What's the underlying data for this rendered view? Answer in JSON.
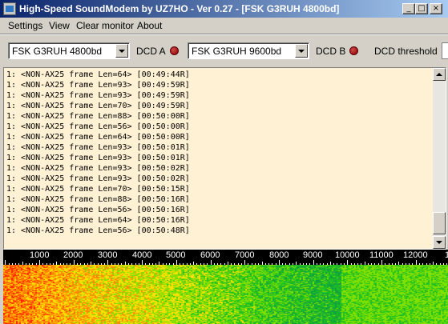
{
  "window": {
    "title": "High-Speed SoundModem by UZ7HO - Ver 0.27 - [FSK G3RUH 4800bd]",
    "minimize_glyph": "_",
    "maximize_glyph": "□",
    "close_glyph": "×"
  },
  "menu": {
    "settings": "Settings",
    "view": "View",
    "clear_monitor": "Clear monitor",
    "about": "About"
  },
  "toolbar": {
    "modem_a": "FSK G3RUH 4800bd",
    "dcd_a_label": "DCD A",
    "modem_b": "FSK G3RUH 9600bd",
    "dcd_b_label": "DCD B",
    "dcd_threshold_label": "DCD threshold",
    "led_color": "#8b0000"
  },
  "monitor": {
    "background": "#fff1d4",
    "lines": [
      "1: <NON-AX25 frame Len=64> [00:49:44R]",
      "1: <NON-AX25 frame Len=93> [00:49:59R]",
      "1: <NON-AX25 frame Len=93> [00:49:59R]",
      "1: <NON-AX25 frame Len=70> [00:49:59R]",
      "1: <NON-AX25 frame Len=88> [00:50:00R]",
      "1: <NON-AX25 frame Len=56> [00:50:00R]",
      "1: <NON-AX25 frame Len=64> [00:50:00R]",
      "1: <NON-AX25 frame Len=93> [00:50:01R]",
      "1: <NON-AX25 frame Len=93> [00:50:01R]",
      "1: <NON-AX25 frame Len=93> [00:50:02R]",
      "1: <NON-AX25 frame Len=93> [00:50:02R]",
      "1: <NON-AX25 frame Len=70> [00:50:15R]",
      "1: <NON-AX25 frame Len=88> [00:50:16R]",
      "1: <NON-AX25 frame Len=56> [00:50:16R]",
      "1: <NON-AX25 frame Len=64> [00:50:16R]",
      "1: <NON-AX25 frame Len=56> [00:50:48R]"
    ]
  },
  "spectrum": {
    "frequency_labels": [
      "1000",
      "2000",
      "3000",
      "4000",
      "5000",
      "6000",
      "7000",
      "8000",
      "9000",
      "10000",
      "11000",
      "12000",
      "13"
    ],
    "waterfall_colors": [
      "#ff2200",
      "#ff8800",
      "#ffe000",
      "#80e000",
      "#20c020",
      "#10a040"
    ]
  }
}
